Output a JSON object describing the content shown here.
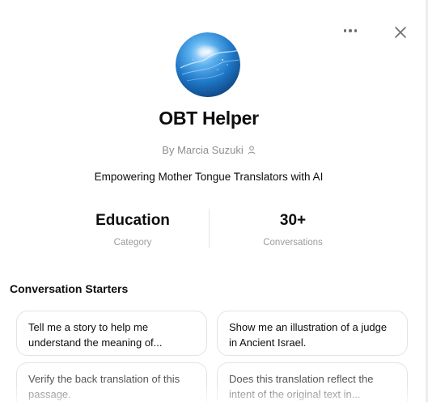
{
  "gpt": {
    "name": "OBT Helper",
    "author": "By Marcia Suzuki",
    "description": "Empowering Mother Tongue Translators with AI"
  },
  "stats": [
    {
      "value": "Education",
      "label": "Category"
    },
    {
      "value": "30+",
      "label": "Conversations"
    }
  ],
  "starters_section": {
    "title": "Conversation Starters",
    "items": [
      {
        "text": "Tell me a story to help me understand the meaning of..."
      },
      {
        "text": "Show me an illustration of a judge in Ancient Israel."
      },
      {
        "text": "Verify the back translation of this passage."
      },
      {
        "text": "Does this translation reflect the intent of the original text in..."
      }
    ]
  },
  "icons": {
    "more": "more-horizontal-icon",
    "close": "close-icon",
    "author": "person-icon"
  },
  "colors": {
    "text": "#0d0d0d",
    "muted": "#8e8e8e",
    "border": "#e3e3e3",
    "avatar_blue": "#1e7fd0"
  }
}
